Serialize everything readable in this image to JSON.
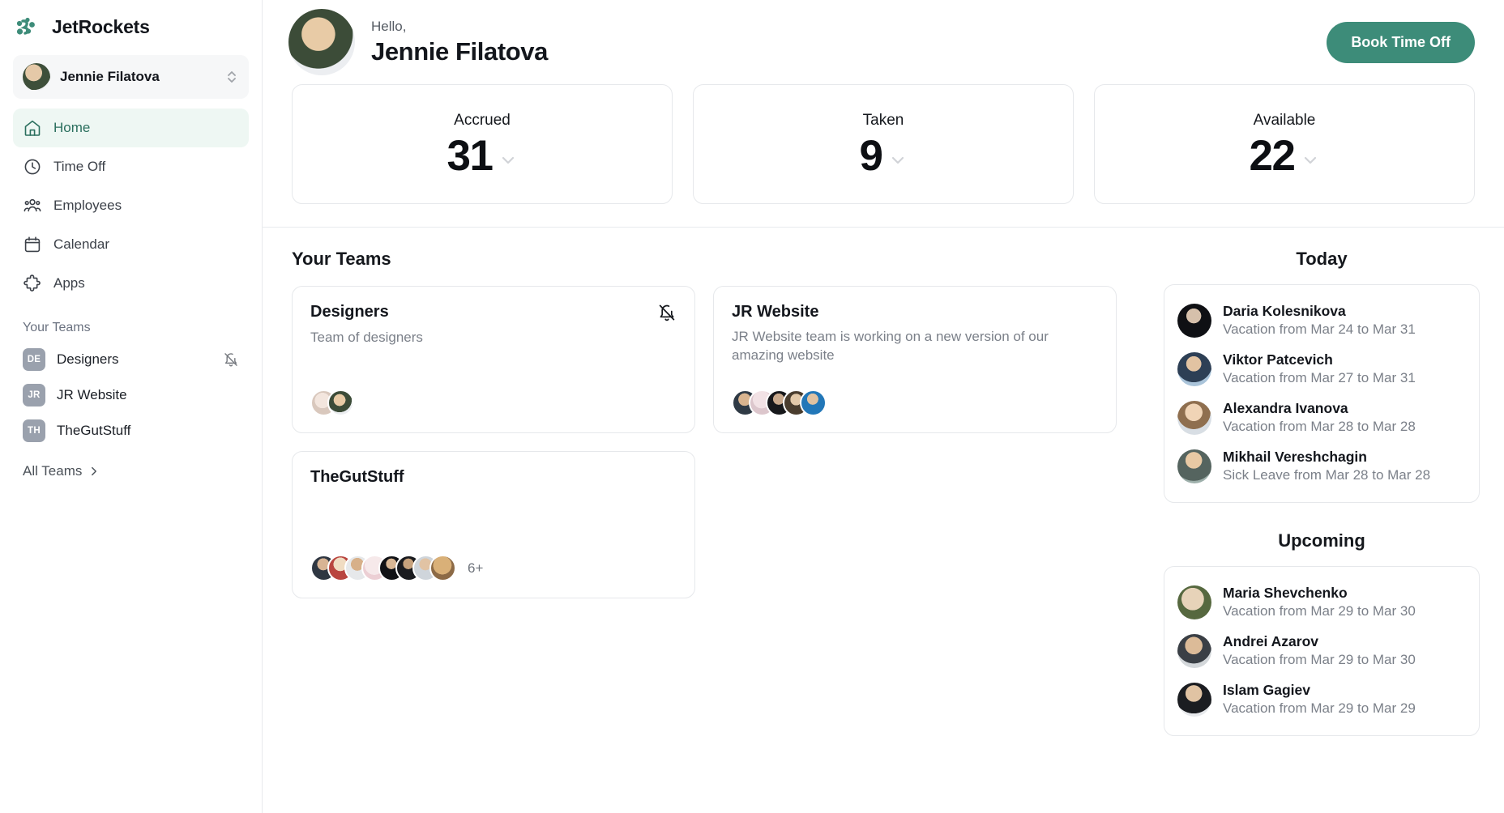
{
  "brand": {
    "name": "JetRockets",
    "logo_icon": "jetrockets-logo-icon",
    "accent_color": "#3d8c79"
  },
  "user_switcher": {
    "name": "Jennie Filatova",
    "icon": "chevron-up-down-icon"
  },
  "sidebar": {
    "nav_items": [
      {
        "label": "Home",
        "icon": "home-icon",
        "active": true
      },
      {
        "label": "Time Off",
        "icon": "clock-icon",
        "active": false
      },
      {
        "label": "Employees",
        "icon": "people-icon",
        "active": false
      },
      {
        "label": "Calendar",
        "icon": "calendar-icon",
        "active": false
      },
      {
        "label": "Apps",
        "icon": "puzzle-icon",
        "active": false
      }
    ],
    "teams_section_label": "Your Teams",
    "teams": [
      {
        "initials": "DE",
        "label": "Designers",
        "muted": true,
        "mute_icon": "bell-off-icon"
      },
      {
        "initials": "JR",
        "label": "JR Website",
        "muted": false
      },
      {
        "initials": "TH",
        "label": "TheGutStuff",
        "muted": false
      }
    ],
    "all_teams_label": "All Teams",
    "all_teams_icon": "chevron-right-icon"
  },
  "header": {
    "greeting": "Hello,",
    "user_name": "Jennie Filatova",
    "avatar_icon": "user-avatar",
    "book_button_label": "Book Time Off"
  },
  "stats": [
    {
      "label": "Accrued",
      "value": "31",
      "icon": "chevron-down-icon"
    },
    {
      "label": "Taken",
      "value": "9",
      "icon": "chevron-down-icon"
    },
    {
      "label": "Available",
      "value": "22",
      "icon": "chevron-down-icon"
    }
  ],
  "teams_panel": {
    "title": "Your Teams",
    "cards": [
      {
        "title": "Designers",
        "description": "Team of designers",
        "muted": true,
        "mute_icon": "bell-off-icon",
        "member_count_label": "",
        "avatars": [
          "#d6cfc7",
          "#3e4f3a"
        ]
      },
      {
        "title": "JR Website",
        "description": "JR Website team is working on a new version of our amazing website",
        "muted": false,
        "member_count_label": "",
        "avatars": [
          "#3a3f47",
          "#e8d9dd",
          "#1d1f22",
          "#4a3f32",
          "#2c6ca8"
        ]
      },
      {
        "title": "TheGutStuff",
        "description": "",
        "muted": false,
        "member_count_label": "6+",
        "avatars": [
          "#2f3742",
          "#d8c4a0",
          "#6a5a4c",
          "#efe2e4",
          "#141518",
          "#1c1d20",
          "#cfd4da",
          "#a0825c"
        ]
      }
    ]
  },
  "today_panel": {
    "title": "Today",
    "rows": [
      {
        "name": "Daria Kolesnikova",
        "detail": "Vacation from Mar 24 to Mar 31",
        "avatar": "#121318"
      },
      {
        "name": "Viktor Patcevich",
        "detail": "Vacation from Mar 27 to Mar 31",
        "avatar": "#6f8ea8"
      },
      {
        "name": "Alexandra Ivanova",
        "detail": "Vacation from Mar 28 to Mar 28",
        "avatar": "#c9bba8"
      },
      {
        "name": "Mikhail Vereshchagin",
        "detail": "Sick Leave from Mar 28 to Mar 28",
        "avatar": "#7d8a84"
      }
    ]
  },
  "upcoming_panel": {
    "title": "Upcoming",
    "rows": [
      {
        "name": "Maria Shevchenko",
        "detail": "Vacation from Mar 29 to Mar 30",
        "avatar": "#5c6b45"
      },
      {
        "name": "Andrei Azarov",
        "detail": "Vacation from Mar 29 to Mar 30",
        "avatar": "#9b9f9d"
      },
      {
        "name": "Islam Gagiev",
        "detail": "Vacation from Mar 29 to Mar 29",
        "avatar": "#4b4f55"
      }
    ]
  }
}
